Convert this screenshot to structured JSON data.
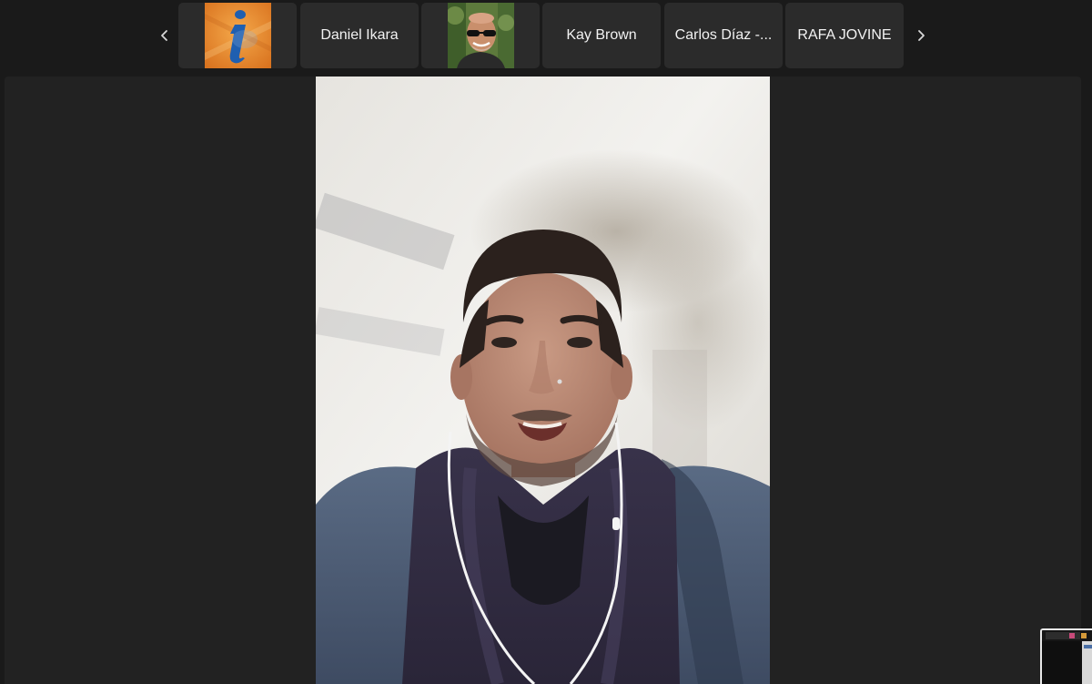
{
  "participants_strip": {
    "tiles": [
      {
        "kind": "avatar",
        "avatar": "info-logo-avatar"
      },
      {
        "kind": "name",
        "name": "Daniel Ikara"
      },
      {
        "kind": "avatar",
        "avatar": "man-with-sunglasses-avatar"
      },
      {
        "kind": "name",
        "name": "Kay Brown"
      },
      {
        "kind": "name",
        "name": "Carlos Díaz -..."
      },
      {
        "kind": "name",
        "name": "RAFA JOVINE"
      }
    ],
    "prev_icon": "chevron-left-icon",
    "next_icon": "chevron-right-icon"
  },
  "main_video": {
    "subject": "speaker-video-feed"
  },
  "self_view": {
    "subject": "self-view-thumbnail"
  },
  "colors": {
    "background": "#1a1a1a",
    "tile": "#2b2b2b",
    "stage": "#222222",
    "text": "#f2f2f2",
    "info_orange": "#e8892e",
    "info_blue": "#1f5fb0"
  }
}
